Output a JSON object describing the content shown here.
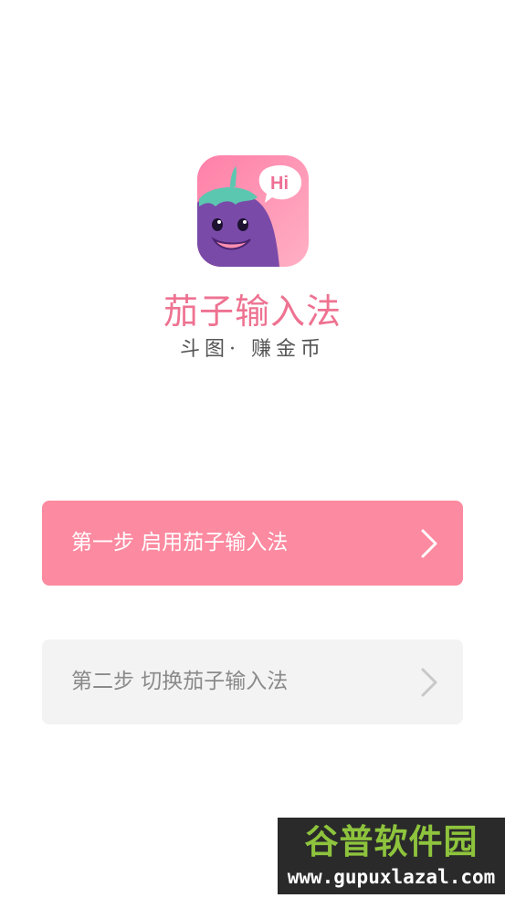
{
  "app": {
    "name": "茄子输入法",
    "slogan": "斗图· 赚金币"
  },
  "icon": {
    "bubble_text": "Hi"
  },
  "steps": [
    {
      "label": "第一步 启用茄子输入法",
      "state": "active"
    },
    {
      "label": "第二步 切换茄子输入法",
      "state": "inactive"
    }
  ],
  "watermark": {
    "title": "谷普软件园",
    "url": "www.gupuxlazal.com"
  },
  "colors": {
    "accent_pink": "#fc8aa0",
    "title_pink": "#ee7291",
    "inactive_gray": "#f3f3f3",
    "eggplant_purple": "#7a4aa8",
    "leaf_teal": "#5cc7b0",
    "watermark_green": "#8ec43d"
  }
}
